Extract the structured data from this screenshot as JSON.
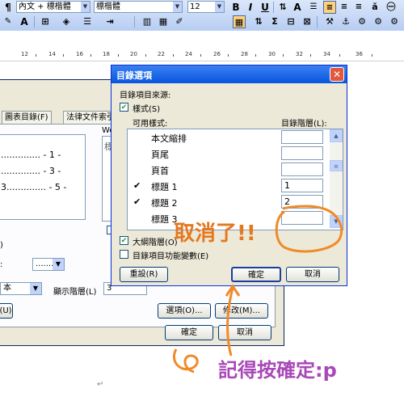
{
  "toolbar": {
    "style_combo": "內文 + 標楷體",
    "font_combo": "標楷體",
    "size_combo": "12",
    "bold": "B",
    "italic": "I",
    "underline": "U",
    "font_color": "A"
  },
  "ruler": {
    "numbers": [
      "12",
      "14",
      "16",
      "18",
      "20",
      "22",
      "24",
      "26",
      "28",
      "30",
      "32",
      "34",
      "36"
    ]
  },
  "back_dialog": {
    "tabs": [
      "圖表目錄(F)",
      "法律文件索引"
    ],
    "preview_lines": [
      ".............. - 1 -",
      ".............. - 3 -",
      "3.............. - 5 -"
    ],
    "right_preview_label": "We",
    "right_preview_char": "標",
    "tab_leader_value": ".......",
    "format_value": "本",
    "show_levels_label": "顯示階層(L)",
    "show_levels_value": "3",
    "u_button": "(U)",
    "options_button": "選項(O)...",
    "modify_button": "修改(M)...",
    "ok_button": "確定",
    "cancel_button": "取消"
  },
  "dialog": {
    "title": "目錄選項",
    "source_label": "目錄項目來源:",
    "styles_label": "樣式(S)",
    "available_styles_label": "可用樣式:",
    "toc_level_label": "目錄階層(L):",
    "styles": [
      {
        "name": "本文縮排",
        "checked": false,
        "level": ""
      },
      {
        "name": "頁尾",
        "checked": false,
        "level": ""
      },
      {
        "name": "頁首",
        "checked": false,
        "level": ""
      },
      {
        "name": "標題 1",
        "checked": true,
        "level": "1"
      },
      {
        "name": "標題 2",
        "checked": true,
        "level": "2"
      },
      {
        "name": "標題 3",
        "checked": false,
        "level": ""
      }
    ],
    "outline_levels_label": "大綱階層(O)",
    "toc_fields_label": "目錄項目功能變數(E)",
    "reset_button": "重設(R)",
    "ok_button": "確定",
    "cancel_button": "取消"
  },
  "annotations": {
    "cancelled_text": "取消了!!",
    "remember_text": "記得按確定:p",
    "color": "#e5781f",
    "text_color": "#a848b8"
  }
}
